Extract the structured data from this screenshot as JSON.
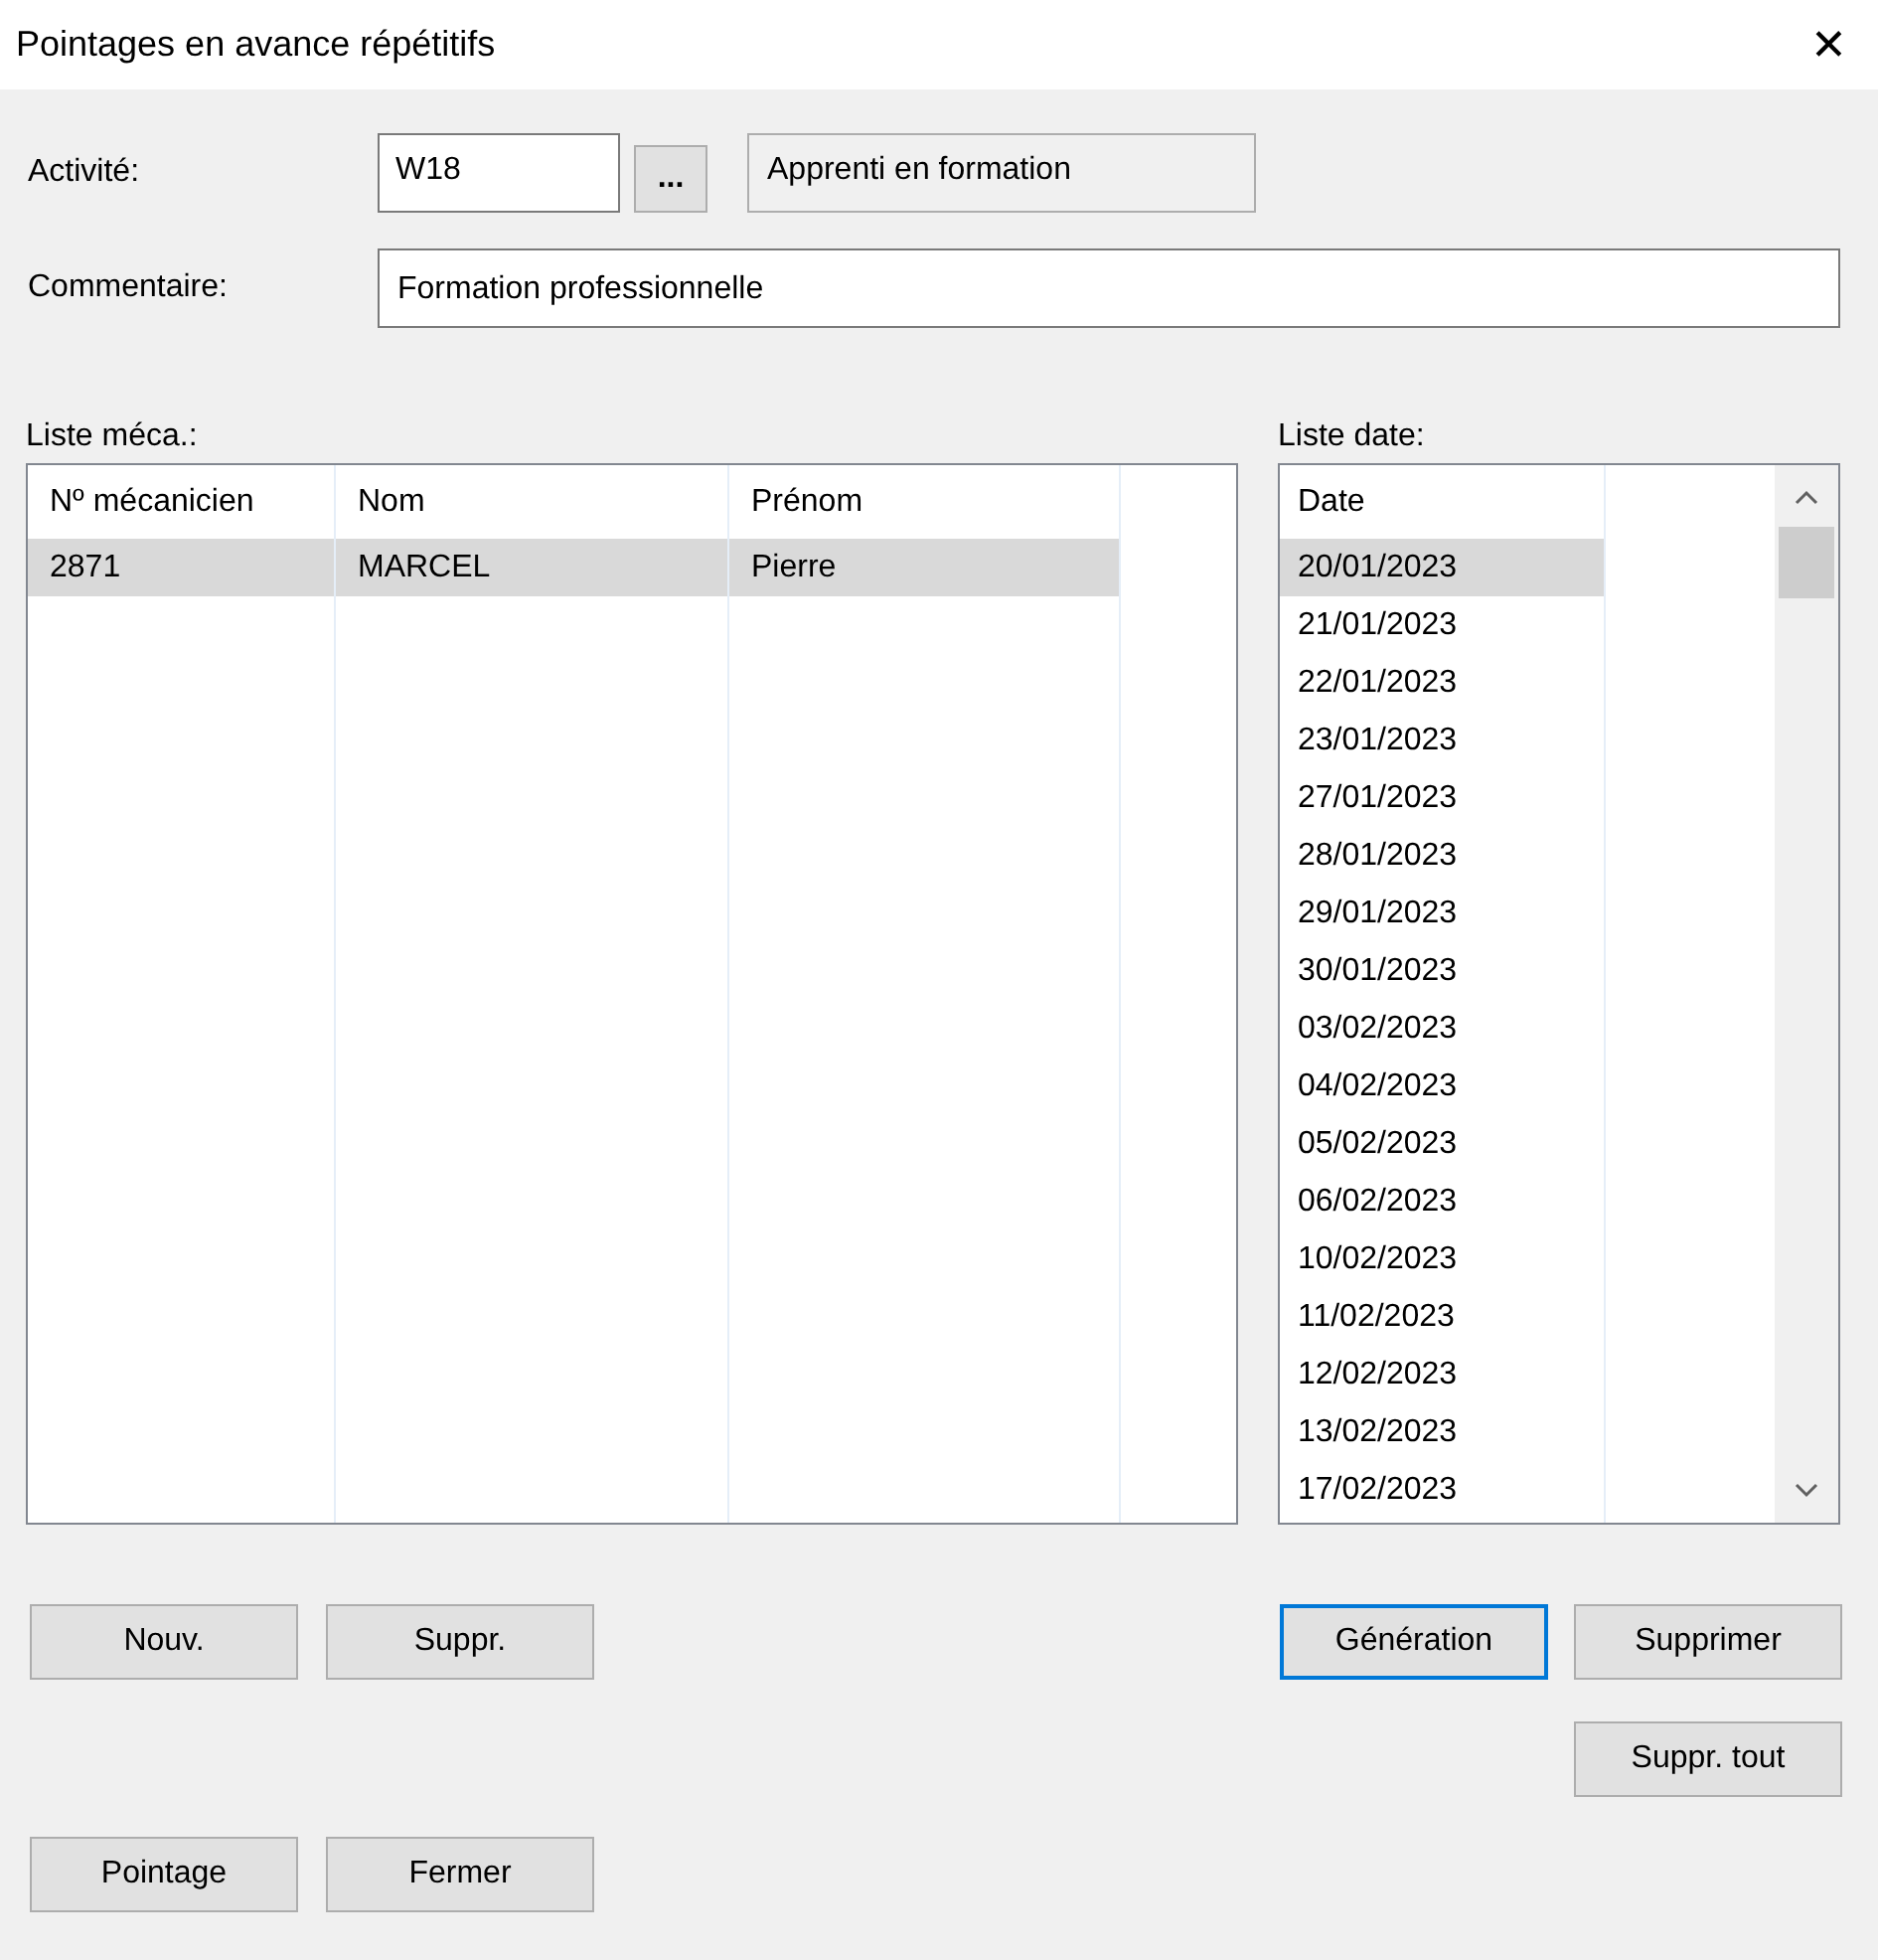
{
  "window": {
    "title": "Pointages en avance répétitifs",
    "close": "✕"
  },
  "activity": {
    "label": "Activité:",
    "value": "W18",
    "browse": "...",
    "description": "Apprenti en formation"
  },
  "comment": {
    "label": "Commentaire:",
    "value": "Formation professionnelle"
  },
  "mechanics": {
    "label": "Liste méca.:",
    "columns": [
      "Nº mécanicien",
      "Nom",
      "Prénom"
    ],
    "rows": [
      {
        "cells": [
          "2871",
          "MARCEL",
          "Pierre"
        ],
        "selected": true
      }
    ]
  },
  "dates": {
    "label": "Liste date:",
    "column": "Date",
    "rows": [
      {
        "value": "20/01/2023",
        "selected": true
      },
      {
        "value": "21/01/2023",
        "selected": false
      },
      {
        "value": "22/01/2023",
        "selected": false
      },
      {
        "value": "23/01/2023",
        "selected": false
      },
      {
        "value": "27/01/2023",
        "selected": false
      },
      {
        "value": "28/01/2023",
        "selected": false
      },
      {
        "value": "29/01/2023",
        "selected": false
      },
      {
        "value": "30/01/2023",
        "selected": false
      },
      {
        "value": "03/02/2023",
        "selected": false
      },
      {
        "value": "04/02/2023",
        "selected": false
      },
      {
        "value": "05/02/2023",
        "selected": false
      },
      {
        "value": "06/02/2023",
        "selected": false
      },
      {
        "value": "10/02/2023",
        "selected": false
      },
      {
        "value": "11/02/2023",
        "selected": false
      },
      {
        "value": "12/02/2023",
        "selected": false
      },
      {
        "value": "13/02/2023",
        "selected": false
      },
      {
        "value": "17/02/2023",
        "selected": false
      }
    ]
  },
  "mechanic_buttons": [
    {
      "label": "Nouv.",
      "default": false
    },
    {
      "label": "Suppr.",
      "default": false
    }
  ],
  "date_buttons": [
    {
      "label": "Génération",
      "default": true
    },
    {
      "label": "Supprimer",
      "default": false
    }
  ],
  "clear_button": {
    "label": "Suppr. tout",
    "default": false
  },
  "footer_buttons": [
    {
      "label": "Pointage",
      "default": false
    },
    {
      "label": "Fermer",
      "default": false
    }
  ]
}
